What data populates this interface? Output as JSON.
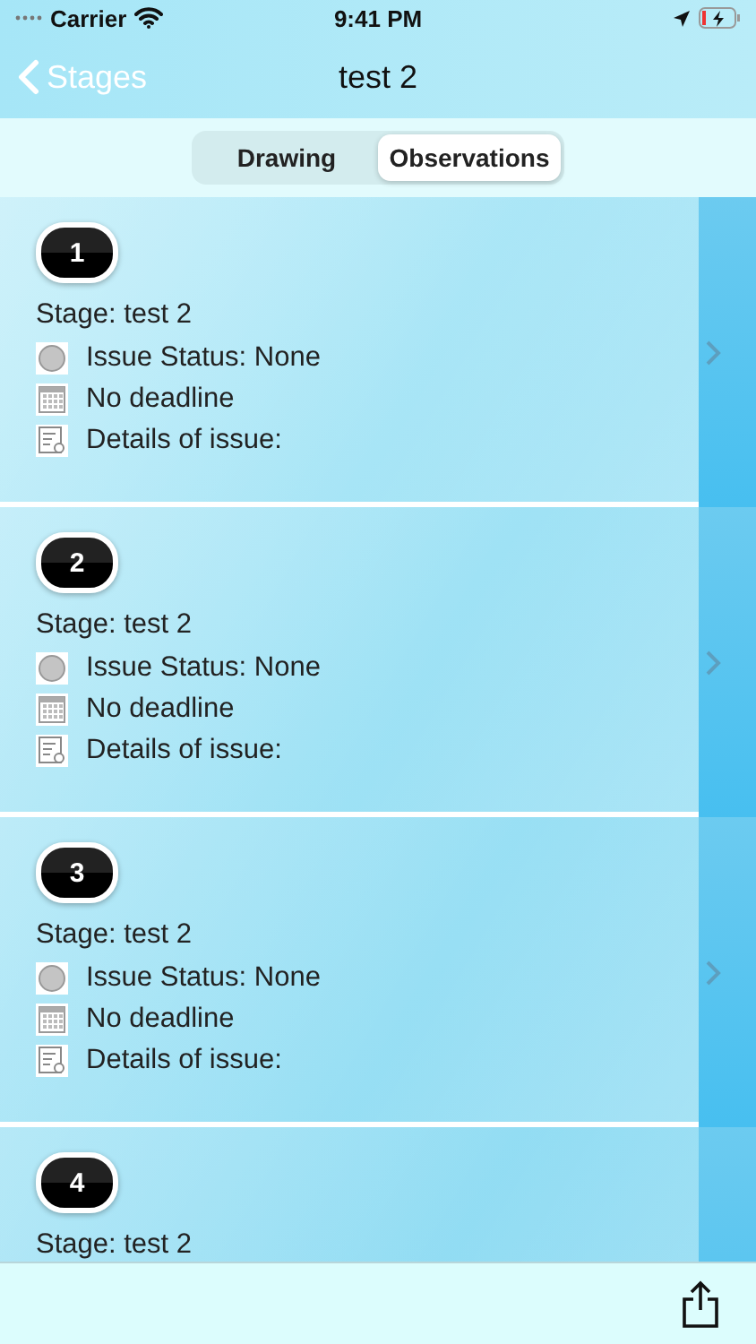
{
  "status_bar": {
    "carrier": "Carrier",
    "time": "9:41 PM"
  },
  "nav": {
    "back": "Stages",
    "title": "test 2"
  },
  "segments": [
    {
      "label": "Drawing",
      "selected": false
    },
    {
      "label": "Observations",
      "selected": true
    }
  ],
  "observations": [
    {
      "number": "1",
      "stage": "Stage: test 2",
      "status": "Issue Status: None",
      "deadline": "No deadline",
      "details": "Details of issue:"
    },
    {
      "number": "2",
      "stage": "Stage: test 2",
      "status": "Issue Status: None",
      "deadline": "No deadline",
      "details": "Details of issue:"
    },
    {
      "number": "3",
      "stage": "Stage: test 2",
      "status": "Issue Status: None",
      "deadline": "No deadline",
      "details": "Details of issue:"
    },
    {
      "number": "4",
      "stage": "Stage: test 2"
    }
  ]
}
